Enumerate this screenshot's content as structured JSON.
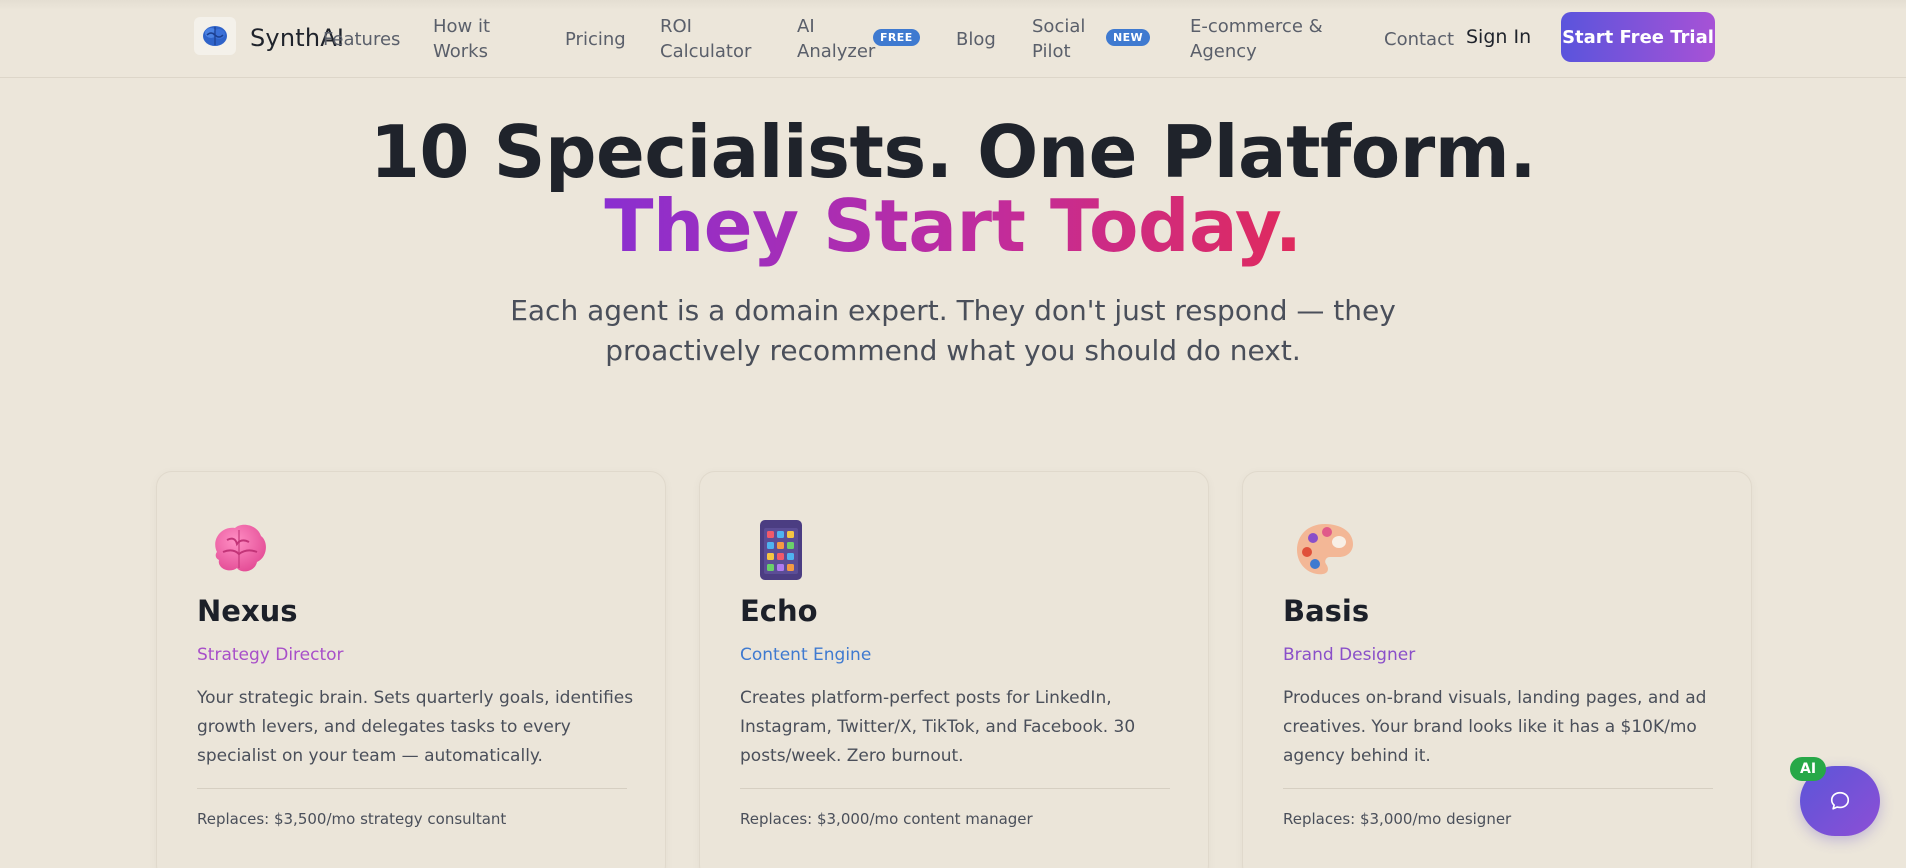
{
  "brand": {
    "name": "SynthAI"
  },
  "nav": {
    "links": [
      {
        "label": "Features"
      },
      {
        "label": "How it\nWorks"
      },
      {
        "label": "Pricing"
      },
      {
        "label": "ROI\nCalculator"
      },
      {
        "label": "AI\nAnalyzer",
        "badge": "FREE"
      },
      {
        "label": "Blog"
      },
      {
        "label": "Social\nPilot",
        "badge": "NEW"
      },
      {
        "label": "E-commerce &\nAgency"
      },
      {
        "label": "Contact"
      }
    ],
    "sign_in": "Sign In",
    "cta": "Start Free Trial"
  },
  "hero": {
    "line1": "10 Specialists. One Platform.",
    "line2": "They Start Today.",
    "subtitle": "Each agent is a domain expert. They don't just respond — they proactively recommend what you should do next."
  },
  "cards": [
    {
      "name": "Nexus",
      "role": "Strategy Director",
      "role_color": "#a84fc9",
      "icon": "brain-icon",
      "description": "Your strategic brain. Sets quarterly goals, identifies growth levers, and delegates tasks to every specialist on your team — automatically.",
      "replaces": "Replaces: $3,500/mo strategy consultant"
    },
    {
      "name": "Echo",
      "role": "Content Engine",
      "role_color": "#3f7ad0",
      "icon": "mobile-phone-icon",
      "description": "Creates platform-perfect posts for LinkedIn, Instagram, Twitter/X, TikTok, and Facebook. 30 posts/week. Zero burnout.",
      "replaces": "Replaces: $3,000/mo content manager"
    },
    {
      "name": "Basis",
      "role": "Brand Designer",
      "role_color": "#8a4fc9",
      "icon": "palette-icon",
      "description": "Produces on-brand visuals, landing pages, and ad creatives. Your brand looks like it has a $10K/mo agency behind it.",
      "replaces": "Replaces: $3,000/mo designer"
    }
  ],
  "chat": {
    "badge": "AI",
    "icon": "chat-bubble-icon"
  }
}
